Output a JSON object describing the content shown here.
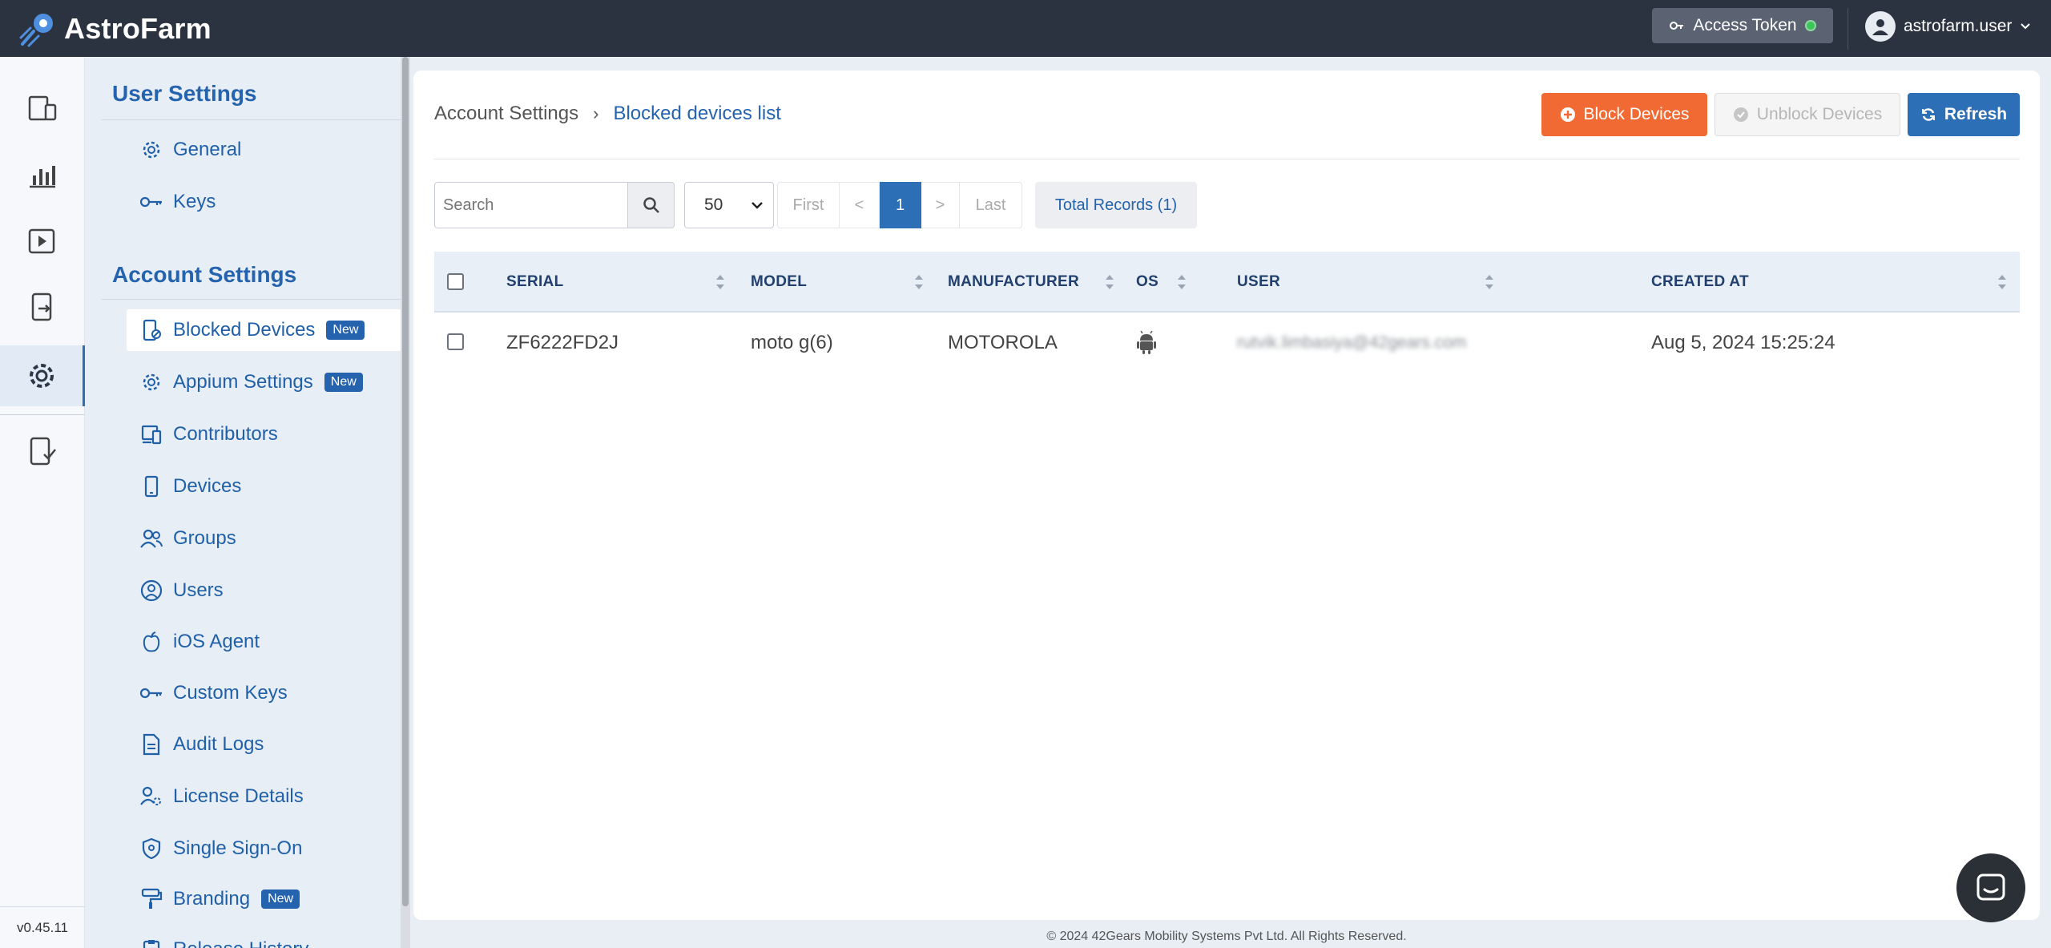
{
  "app": {
    "title": "AstroFarm",
    "version": "v0.45.11"
  },
  "topbar": {
    "access_token_label": "Access Token",
    "user_name": "astrofarm.user"
  },
  "sidebar": {
    "user_settings_title": "User Settings",
    "user_settings_items": [
      {
        "label": "General",
        "icon": "gear-icon"
      },
      {
        "label": "Keys",
        "icon": "key-icon"
      }
    ],
    "account_settings_title": "Account Settings",
    "account_settings_items": [
      {
        "label": "Blocked Devices",
        "icon": "blocked-device-icon",
        "badge": "New",
        "active": true
      },
      {
        "label": "Appium Settings",
        "icon": "gear-icon",
        "badge": "New"
      },
      {
        "label": "Contributors",
        "icon": "contributors-icon"
      },
      {
        "label": "Devices",
        "icon": "phone-icon"
      },
      {
        "label": "Groups",
        "icon": "groups-icon"
      },
      {
        "label": "Users",
        "icon": "user-icon"
      },
      {
        "label": "iOS Agent",
        "icon": "apple-icon"
      },
      {
        "label": "Custom Keys",
        "icon": "key-icon"
      },
      {
        "label": "Audit Logs",
        "icon": "document-icon"
      },
      {
        "label": "License Details",
        "icon": "license-icon"
      },
      {
        "label": "Single Sign-On",
        "icon": "shield-icon"
      },
      {
        "label": "Branding",
        "icon": "paint-roller-icon",
        "badge": "New"
      },
      {
        "label": "Release History",
        "icon": "clipboard-icon"
      }
    ]
  },
  "main": {
    "breadcrumb": {
      "parent": "Account Settings",
      "separator": "›",
      "current": "Blocked devices list"
    },
    "buttons": {
      "block": "Block Devices",
      "unblock": "Unblock Devices",
      "refresh": "Refresh"
    },
    "search": {
      "placeholder": "Search"
    },
    "page_size": "50",
    "pager": {
      "first": "First",
      "prev": "<",
      "current": "1",
      "next": ">",
      "last": "Last"
    },
    "total_records": "Total Records (1)",
    "table": {
      "headers": [
        "SERIAL",
        "MODEL",
        "MANUFACTURER",
        "OS",
        "USER",
        "CREATED AT"
      ],
      "rows": [
        {
          "serial": "ZF6222FD2J",
          "model": "moto g(6)",
          "manufacturer": "MOTOROLA",
          "os": "android-icon",
          "user": "rutvik.limbasiya@42gears.com",
          "created_at": "Aug 5, 2024 15:25:24"
        }
      ]
    }
  },
  "footer": {
    "copyright": "© 2024 42Gears Mobility Systems Pvt Ltd. All Rights Reserved."
  },
  "colors": {
    "topbar": "#2c3340",
    "primary": "#2d6fb7",
    "link": "#2563ae",
    "danger_button": "#f26a33",
    "status_online": "#3cc55b"
  }
}
